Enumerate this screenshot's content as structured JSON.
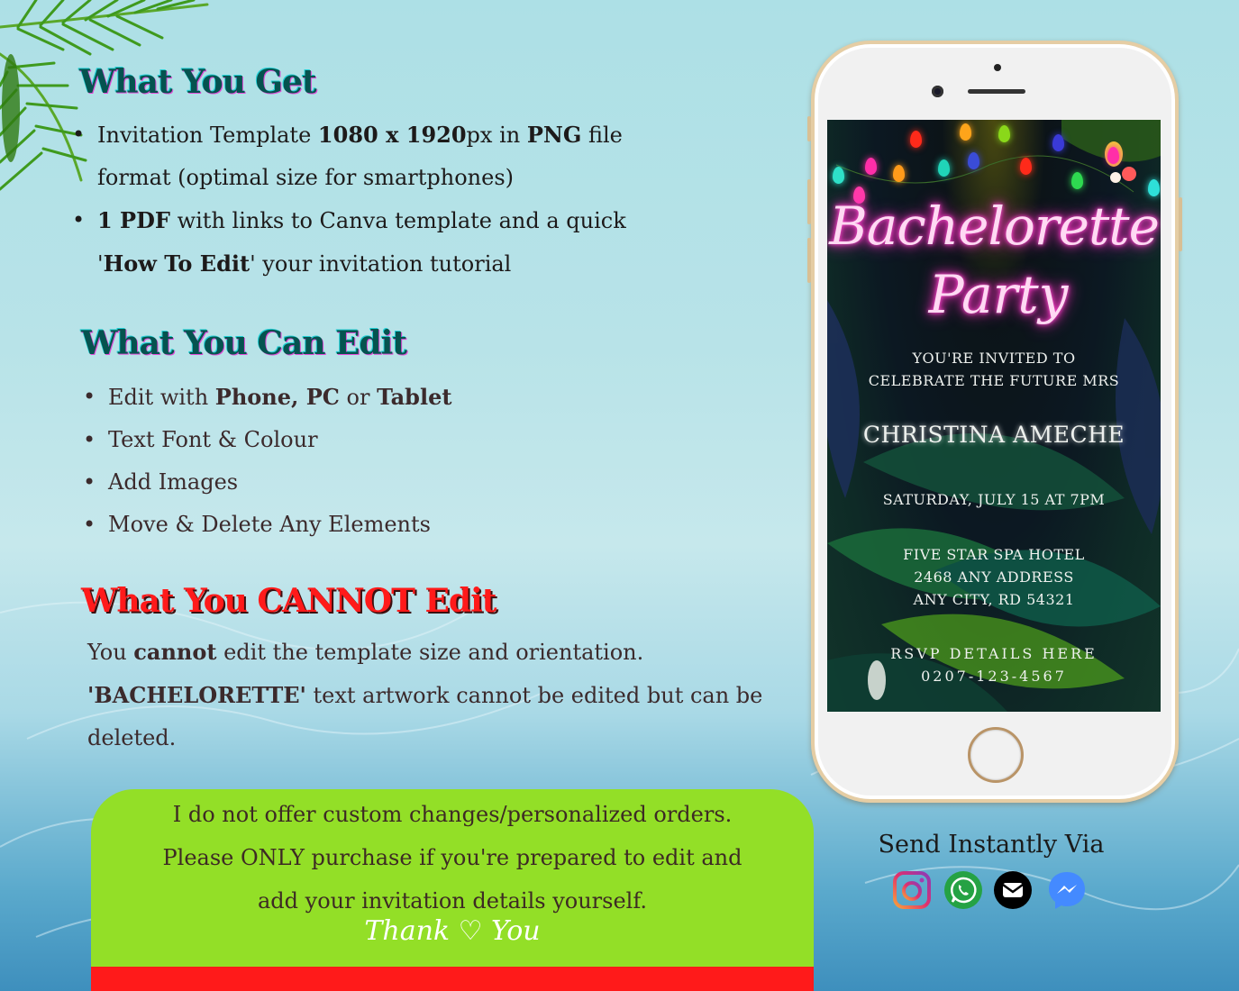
{
  "sections": {
    "get": {
      "title": "What You Get",
      "items": [
        {
          "parts": [
            {
              "t": "Invitation Template ",
              "b": false
            },
            {
              "t": "1080 x 1920",
              "b": true
            },
            {
              "t": "px in ",
              "b": false
            },
            {
              "t": "PNG",
              "b": true
            },
            {
              "t": "  file format (optimal size for smartphones)",
              "b": false
            }
          ]
        },
        {
          "parts": [
            {
              "t": "1 PDF",
              "b": true
            },
            {
              "t": " with links to Canva template and a quick '",
              "b": false
            },
            {
              "t": "How To Edit",
              "b": true
            },
            {
              "t": "' your invitation tutorial",
              "b": false
            }
          ]
        }
      ]
    },
    "can_edit": {
      "title": "What You Can Edit",
      "items": [
        {
          "parts": [
            {
              "t": "Edit with ",
              "b": false
            },
            {
              "t": "Phone, PC",
              "b": true
            },
            {
              "t": " or ",
              "b": false
            },
            {
              "t": "Tablet",
              "b": true
            }
          ]
        },
        {
          "parts": [
            {
              "t": "Text Font & Colour",
              "b": false
            }
          ]
        },
        {
          "parts": [
            {
              "t": "Add Images",
              "b": false
            }
          ]
        },
        {
          "parts": [
            {
              "t": "Move & Delete Any Elements",
              "b": false
            }
          ]
        }
      ]
    },
    "cannot_edit": {
      "title": "What You CANNOT Edit",
      "line1_pre": "You ",
      "line1_bold": "cannot",
      "line1_post": " edit the template size and orientation.",
      "line2_bold": "'BACHELORETTE'",
      "line2_post": " text artwork cannot be edited but can be deleted."
    }
  },
  "notice": {
    "lines": [
      "I do not offer custom changes/personalized orders.",
      "Please ONLY purchase if you're prepared to edit and",
      "add your invitation details yourself."
    ],
    "thanks": "Thank ♡ You"
  },
  "invitation": {
    "title_line1": "Bachelorette",
    "title_line2": "Party",
    "invited_line1": "YOU'RE INVITED TO",
    "invited_line2": "CELEBRATE THE FUTURE MRS",
    "name": "CHRISTINA AMECHE",
    "date": "SATURDAY, JULY 15 AT 7PM",
    "venue_line1": "FIVE STAR SPA HOTEL",
    "venue_line2": "2468 ANY ADDRESS",
    "venue_line3": "ANY CITY, RD 54321",
    "rsvp_line1": "RSVP DETAILS HERE",
    "rsvp_line2": "0207-123-4567"
  },
  "send": {
    "title": "Send Instantly Via",
    "channels": [
      {
        "name": "Instagram",
        "icon": "instagram-icon",
        "color": "#c13584"
      },
      {
        "name": "WhatsApp",
        "icon": "whatsapp-icon",
        "color": "#25a244"
      },
      {
        "name": "Email",
        "icon": "mail-icon",
        "color": "#000000"
      },
      {
        "name": "Messenger",
        "icon": "messenger-icon",
        "color": "#448aff"
      }
    ]
  },
  "colors": {
    "teal_heading": "#05534f",
    "red_heading": "#ff1a1a",
    "notice_green": "#93df27",
    "notice_red": "#ff1a1a",
    "neon_pink": "#ff2ec4"
  }
}
